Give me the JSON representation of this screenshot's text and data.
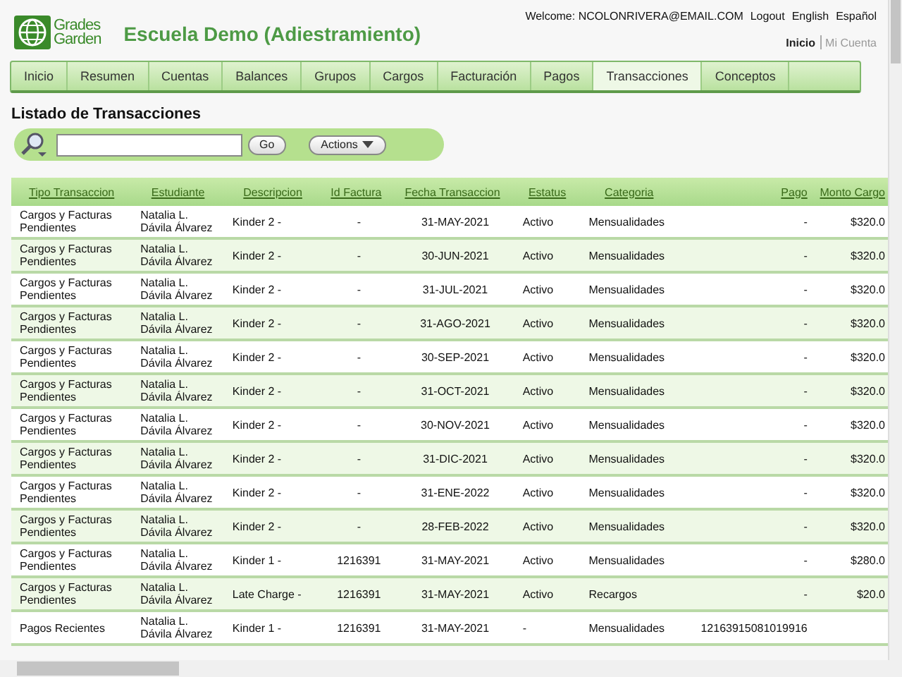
{
  "logo": {
    "line_1": "Grades",
    "line_2": "Garden"
  },
  "school_name": "Escuela Demo (Adiestramiento)",
  "user_links": {
    "welcome": "Welcome: NCOLONRIVERA@EMAIL.COM",
    "links": [
      "Logout",
      "English",
      "Español"
    ]
  },
  "account_links": [
    {
      "label": "Inicio",
      "selected": true
    },
    {
      "label": "Mi Cuenta",
      "selected": false
    }
  ],
  "tabs": [
    {
      "label": "Inicio",
      "selected": false
    },
    {
      "label": "Resumen",
      "selected": false
    },
    {
      "label": "Cuentas",
      "selected": false
    },
    {
      "label": "Balances",
      "selected": false
    },
    {
      "label": "Grupos",
      "selected": false
    },
    {
      "label": "Cargos",
      "selected": false
    },
    {
      "label": "Facturación",
      "selected": false
    },
    {
      "label": "Pagos",
      "selected": false
    },
    {
      "label": "Transacciones",
      "selected": true
    },
    {
      "label": "Conceptos",
      "selected": false
    }
  ],
  "page_title": "Listado de Transacciones",
  "search": {
    "go_button": "Go",
    "actions_button": "Actions"
  },
  "table": {
    "columns": [
      "Tipo Transaccion",
      "Estudiante",
      "Descripcion",
      "Id Factura",
      "Fecha Transaccion",
      "Estatus",
      "Categoria",
      "Pago",
      "Monto Cargo"
    ],
    "rows": [
      [
        "Cargos y Facturas Pendientes",
        "Natalia L. Dávila Álvarez",
        "Kinder 2 -",
        "-",
        "31-MAY-2021",
        "Activo",
        "Mensualidades",
        "-",
        "$320.0"
      ],
      [
        "Cargos y Facturas Pendientes",
        "Natalia L. Dávila Álvarez",
        "Kinder 2 -",
        "-",
        "30-JUN-2021",
        "Activo",
        "Mensualidades",
        "-",
        "$320.0"
      ],
      [
        "Cargos y Facturas Pendientes",
        "Natalia L. Dávila Álvarez",
        "Kinder 2 -",
        "-",
        "31-JUL-2021",
        "Activo",
        "Mensualidades",
        "-",
        "$320.0"
      ],
      [
        "Cargos y Facturas Pendientes",
        "Natalia L. Dávila Álvarez",
        "Kinder 2 -",
        "-",
        "31-AGO-2021",
        "Activo",
        "Mensualidades",
        "-",
        "$320.0"
      ],
      [
        "Cargos y Facturas Pendientes",
        "Natalia L. Dávila Álvarez",
        "Kinder 2 -",
        "-",
        "30-SEP-2021",
        "Activo",
        "Mensualidades",
        "-",
        "$320.0"
      ],
      [
        "Cargos y Facturas Pendientes",
        "Natalia L. Dávila Álvarez",
        "Kinder 2 -",
        "-",
        "31-OCT-2021",
        "Activo",
        "Mensualidades",
        "-",
        "$320.0"
      ],
      [
        "Cargos y Facturas Pendientes",
        "Natalia L. Dávila Álvarez",
        "Kinder 2 -",
        "-",
        "30-NOV-2021",
        "Activo",
        "Mensualidades",
        "-",
        "$320.0"
      ],
      [
        "Cargos y Facturas Pendientes",
        "Natalia L. Dávila Álvarez",
        "Kinder 2 -",
        "-",
        "31-DIC-2021",
        "Activo",
        "Mensualidades",
        "-",
        "$320.0"
      ],
      [
        "Cargos y Facturas Pendientes",
        "Natalia L. Dávila Álvarez",
        "Kinder 2 -",
        "-",
        "31-ENE-2022",
        "Activo",
        "Mensualidades",
        "-",
        "$320.0"
      ],
      [
        "Cargos y Facturas Pendientes",
        "Natalia L. Dávila Álvarez",
        "Kinder 2 -",
        "-",
        "28-FEB-2022",
        "Activo",
        "Mensualidades",
        "-",
        "$320.0"
      ],
      [
        "Cargos y Facturas Pendientes",
        "Natalia L. Dávila Álvarez",
        "Kinder 1 -",
        "1216391",
        "31-MAY-2021",
        "Activo",
        "Mensualidades",
        "-",
        "$280.0"
      ],
      [
        "Cargos y Facturas Pendientes",
        "Natalia L. Dávila Álvarez",
        "Late Charge -",
        "1216391",
        "31-MAY-2021",
        "Activo",
        "Recargos",
        "-",
        "$20.0"
      ],
      [
        "Pagos Recientes",
        "Natalia L. Dávila Álvarez",
        "Kinder 1 -",
        "1216391",
        "31-MAY-2021",
        "-",
        "Mensualidades",
        "12163915081019916",
        ""
      ]
    ]
  }
}
